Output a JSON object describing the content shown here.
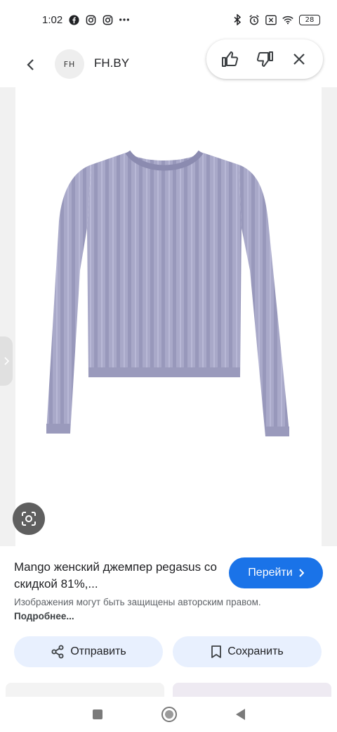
{
  "status_bar": {
    "time": "1:02",
    "battery": "28",
    "left_icons": [
      "facebook-icon",
      "instagram-icon",
      "instagram-icon",
      "more-dots-icon"
    ],
    "right_icons": [
      "bluetooth-icon",
      "alarm-icon",
      "no-sim-icon",
      "wifi-icon",
      "battery-icon"
    ]
  },
  "header": {
    "logo_text": "FH",
    "site_name": "FH.BY"
  },
  "feedback": {
    "icons": [
      "thumbs-up-icon",
      "thumbs-down-icon",
      "close-icon"
    ]
  },
  "product": {
    "title": "Mango женский джемпер pegasus со скидкой 81%,...",
    "goto_label": "Перейти",
    "copyright_text": "Изображения могут быть защищены авторским правом.",
    "more_label": "Подробнее..."
  },
  "actions": {
    "share_label": "Отправить",
    "save_label": "Сохранить"
  },
  "colors": {
    "accent": "#1a73e8",
    "sweater": "#a9a9c9",
    "action_bg": "#e8f0fe"
  }
}
